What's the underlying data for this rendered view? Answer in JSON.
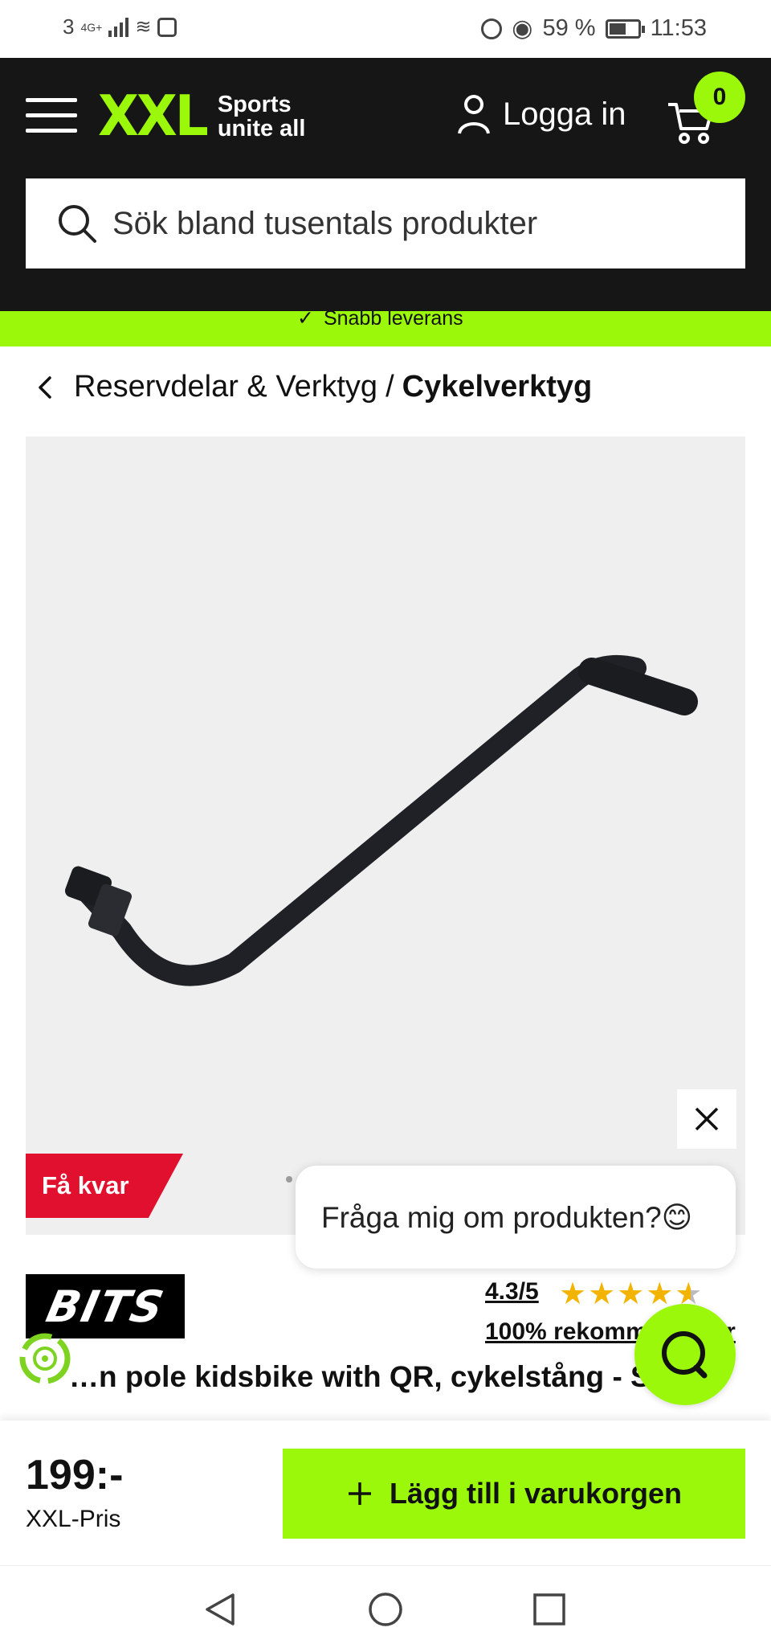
{
  "status_bar": {
    "network": "3",
    "network_type": "4G+",
    "battery_percent": "59 %",
    "time": "11:53"
  },
  "header": {
    "logo_main": "XXL",
    "logo_tagline_1": "Sports",
    "logo_tagline_2": "unite all",
    "login_label": "Logga in",
    "cart_count": "0",
    "search_placeholder": "Sök bland tusentals produkter"
  },
  "banner": {
    "text": "Snabb leverans"
  },
  "breadcrumb": {
    "parent": "Reservdelar & Verktyg",
    "separator": "/",
    "current": "Cykelverktyg"
  },
  "product": {
    "stock_badge": "Få kvar",
    "chat_prompt": "Fråga mig om produkten?😊",
    "brand": "BITS",
    "rating": "4.3/5",
    "rating_value": 4.3,
    "rating_max": 5,
    "stars": "★★★★",
    "half_star": "★",
    "recommend": "100% rekommenderar",
    "title": "…n pole kidsbike with QR, cykelstång - Sv…"
  },
  "buy_bar": {
    "price": "199:-",
    "price_label": "XXL-Pris",
    "add_to_cart_label": "Lägg till i varukorgen"
  },
  "colors": {
    "brand_green": "#9cf80a",
    "header_bg": "#161616",
    "badge_red": "#e0102e",
    "star": "#f2b400"
  },
  "icons": [
    "menu-icon",
    "user-icon",
    "cart-icon",
    "search-icon",
    "chevron-left-icon",
    "close-icon",
    "chat-icon",
    "recycle-icon",
    "plus-icon",
    "back-nav-icon",
    "home-nav-icon",
    "recents-nav-icon"
  ]
}
